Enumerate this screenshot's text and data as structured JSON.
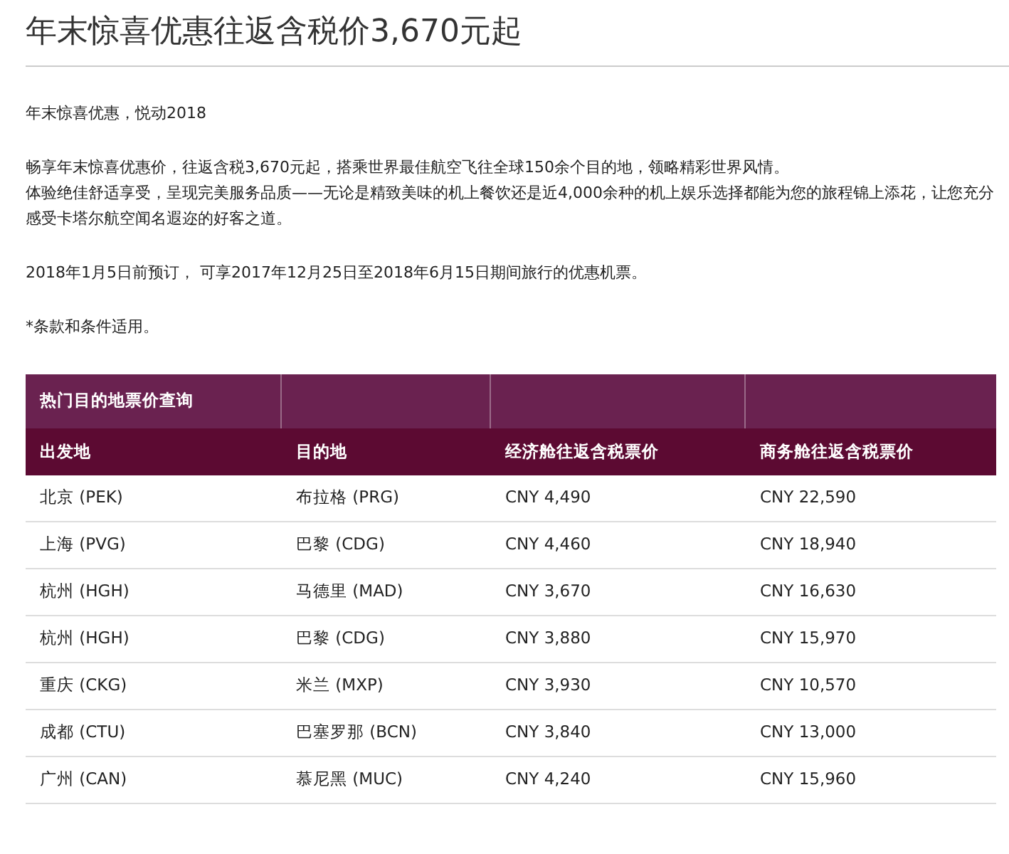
{
  "title": "年末惊喜优惠往返含税价3,670元起",
  "paragraphs": [
    [
      "年末惊喜优惠，悦动2018"
    ],
    [
      "畅享年末惊喜优惠价，往返含税3,670元起，搭乘世界最佳航空飞往全球150余个目的地，领略精彩世界风情。",
      "体验绝佳舒适享受，呈现完美服务品质——无论是精致美味的机上餐饮还是近4,000余种的机上娱乐选择都能为您的旅程锦上添花，让您充分感受卡塔尔航空闻名遐迩的好客之道。"
    ],
    [
      "2018年1月5日前预订， 可享2017年12月25日至2018年6月15日期间旅行的优惠机票。"
    ],
    [
      "*条款和条件适用。"
    ]
  ],
  "table": {
    "caption": "热门目的地票价查询",
    "columns": [
      "出发地",
      "目的地",
      "经济舱往返含税票价",
      "商务舱往返含税票价"
    ],
    "rows": [
      [
        "北京 (PEK)",
        "布拉格 (PRG)",
        "CNY 4,490",
        "CNY 22,590"
      ],
      [
        "上海 (PVG)",
        "巴黎 (CDG)",
        "CNY 4,460",
        "CNY 18,940"
      ],
      [
        "杭州 (HGH)",
        "马德里 (MAD)",
        "CNY 3,670",
        "CNY 16,630"
      ],
      [
        "杭州 (HGH)",
        "巴黎 (CDG)",
        "CNY 3,880",
        "CNY 15,970"
      ],
      [
        "重庆 (CKG)",
        "米兰 (MXP)",
        "CNY 3,930",
        "CNY 10,570"
      ],
      [
        "成都 (CTU)",
        "巴塞罗那 (BCN)",
        "CNY 3,840",
        "CNY 13,000"
      ],
      [
        "广州 (CAN)",
        "慕尼黑 (MUC)",
        "CNY 4,240",
        "CNY 15,960"
      ]
    ]
  }
}
